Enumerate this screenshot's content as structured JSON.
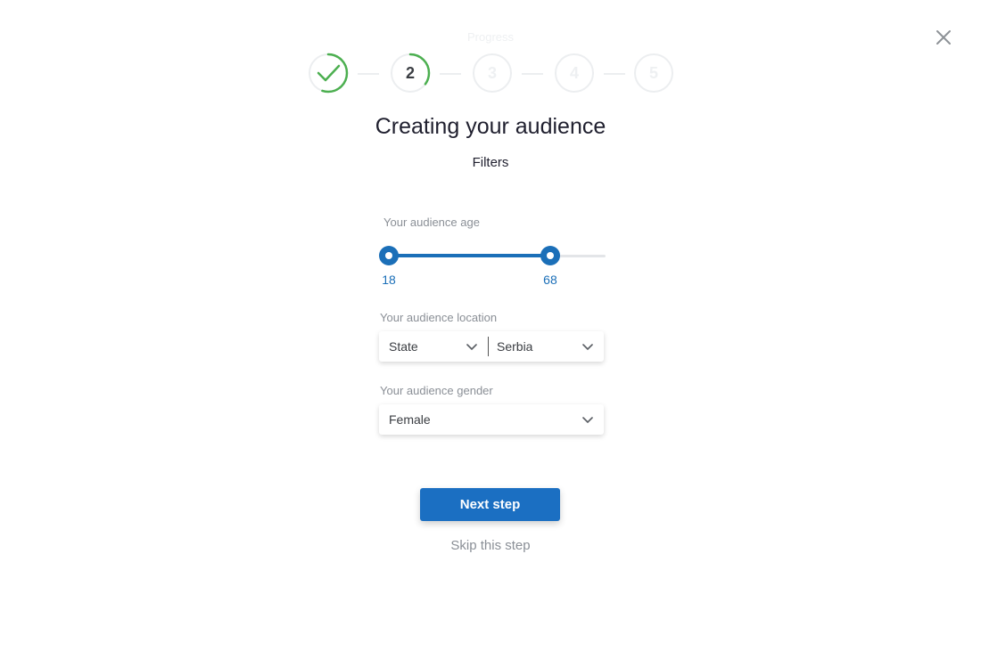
{
  "header": {
    "progress_label": "Progress",
    "close_icon": "close-icon"
  },
  "stepper": {
    "steps": [
      {
        "label": "",
        "state": "completed",
        "icon": "checkmark-icon",
        "progress": 0.55
      },
      {
        "label": "2",
        "state": "active",
        "progress": 0.35
      },
      {
        "label": "3",
        "state": "upcoming",
        "progress": 0
      },
      {
        "label": "4",
        "state": "upcoming",
        "progress": 0
      },
      {
        "label": "5",
        "state": "upcoming",
        "progress": 0
      }
    ]
  },
  "main": {
    "title": "Creating your audience",
    "subtitle": "Filters"
  },
  "age": {
    "label": "Your audience age",
    "min_value": "18",
    "max_value": "68",
    "range_fraction_start": 0,
    "range_fraction_end": 0.78
  },
  "location": {
    "label": "Your audience location",
    "type_value": "State",
    "place_value": "Serbia"
  },
  "gender": {
    "label": "Your audience gender",
    "value": "Female"
  },
  "actions": {
    "next_label": "Next step",
    "skip_label": "Skip this step"
  },
  "colors": {
    "accent": "#1b6fb8",
    "success": "#4caf50",
    "ring_track": "#eceef0",
    "muted_text": "#8a8f96",
    "button_bg": "#1b6fc2"
  }
}
